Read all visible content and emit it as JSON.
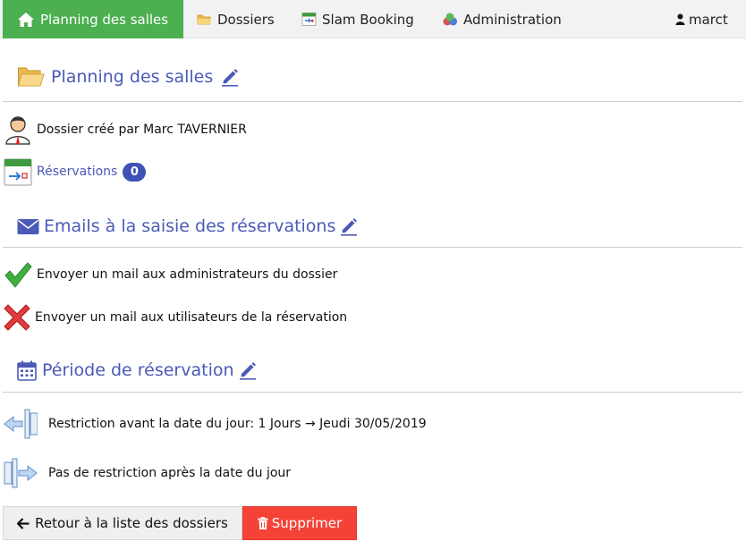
{
  "navbar": {
    "planning_label": "Planning des salles",
    "dossiers_label": "Dossiers",
    "slam_label": "Slam Booking",
    "admin_label": "Administration",
    "user_label": "marct"
  },
  "folder": {
    "title": "Planning des salles",
    "created_by": "Dossier créé par Marc TAVERNIER",
    "reservations_label": "Réservations",
    "reservations_count": "0"
  },
  "emails": {
    "title": "Emails à la saisie des réservations",
    "admin_mail": "Envoyer un mail aux administrateurs du dossier",
    "users_mail": "Envoyer un mail aux utilisateurs de la réservation"
  },
  "period": {
    "title": "Période de réservation",
    "before": "Restriction avant la date du jour: 1 Jours → Jeudi 30/05/2019",
    "after": "Pas de restriction après la date du jour"
  },
  "actions": {
    "back_label": "Retour à la liste des dossiers",
    "delete_label": "Supprimer"
  },
  "colors": {
    "accent": "#4a5ab6",
    "nav_active": "#4caf50",
    "danger": "#f44336",
    "badge": "#3f51b5"
  }
}
